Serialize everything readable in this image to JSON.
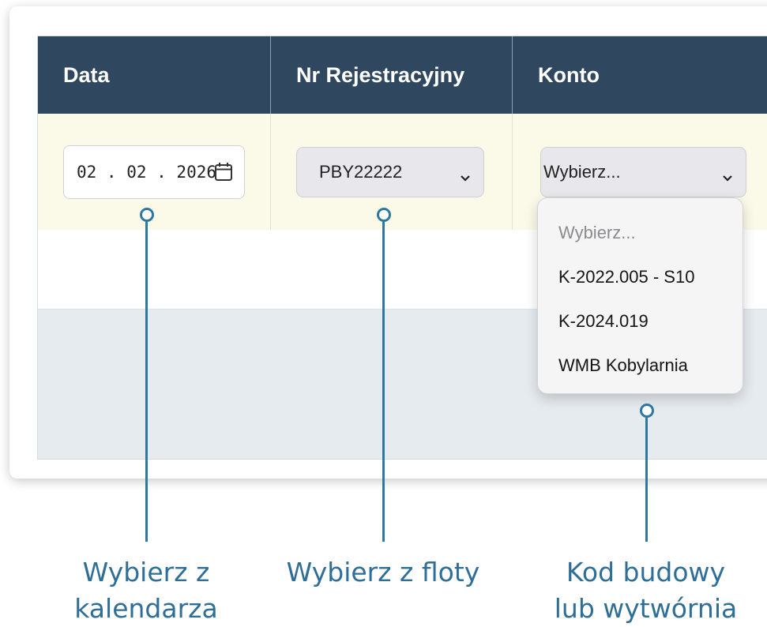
{
  "table": {
    "headers": [
      "Data",
      "Nr Rejestracyjny",
      "Konto"
    ]
  },
  "date_field": {
    "value": "02 . 02 . 2026",
    "icon": "calendar-icon"
  },
  "registration_select": {
    "value": "PBY22222",
    "icon": "chevron-down-icon"
  },
  "account_select": {
    "value": "Wybierz...",
    "icon": "chevron-down-icon",
    "options": [
      "Wybierz...",
      "K-2022.005 - S10",
      "K-2024.019",
      "WMB Kobylarnia"
    ]
  },
  "callouts": {
    "calendar": [
      "Wybierz z",
      "kalendarza"
    ],
    "fleet": [
      "Wybierz z floty"
    ],
    "account": [
      "Kod budowy",
      "lub wytwórnia"
    ]
  },
  "colors": {
    "header_bg": "#2f4860",
    "input_row_bg": "#fbfae9",
    "callout": "#2e78a0"
  }
}
